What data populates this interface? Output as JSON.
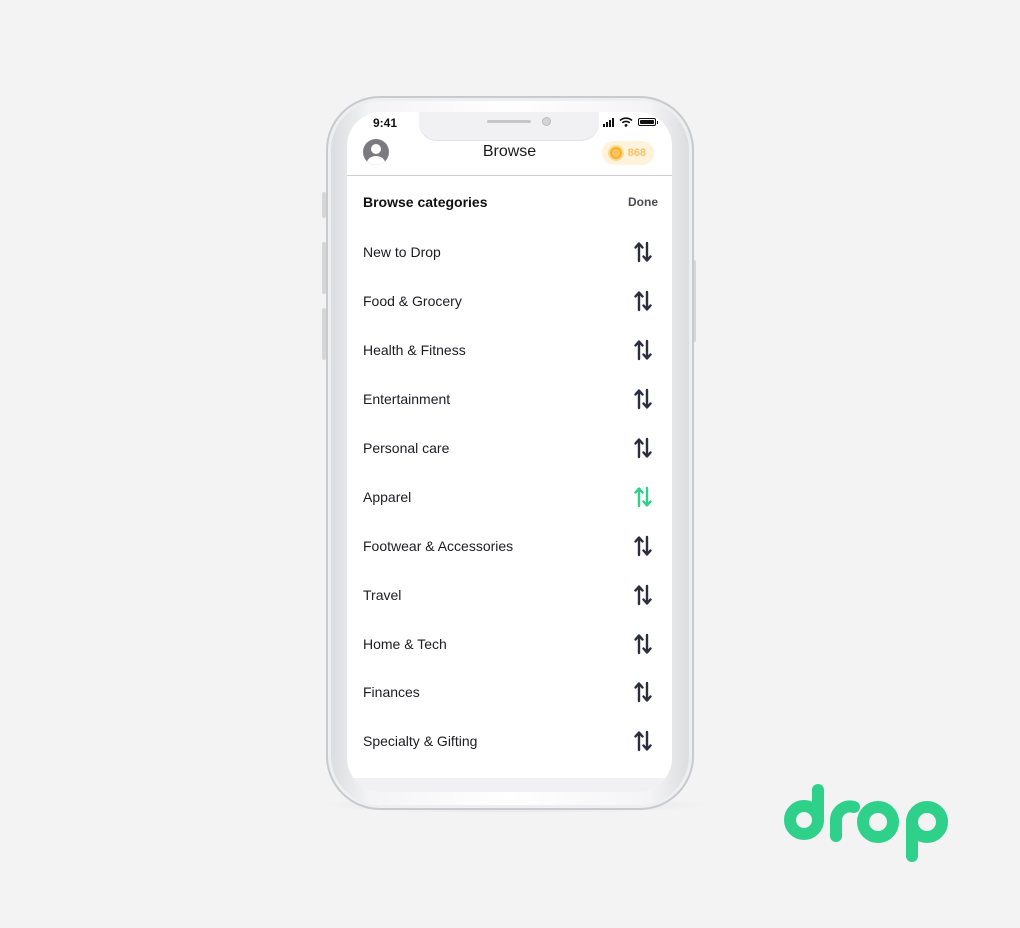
{
  "status_bar": {
    "time": "9:41"
  },
  "header": {
    "title": "Browse",
    "points": "868",
    "icons": {
      "profile": "user-avatar-icon",
      "coin": "coin-icon"
    }
  },
  "browse": {
    "title": "Browse categories",
    "done_label": "Done",
    "categories": [
      {
        "label": "New to Drop",
        "active": false
      },
      {
        "label": "Food & Grocery",
        "active": false
      },
      {
        "label": "Health & Fitness",
        "active": false
      },
      {
        "label": "Entertainment",
        "active": false
      },
      {
        "label": "Personal care",
        "active": false
      },
      {
        "label": "Apparel",
        "active": true
      },
      {
        "label": "Footwear & Accessories",
        "active": false
      },
      {
        "label": "Travel",
        "active": false
      },
      {
        "label": "Home & Tech",
        "active": false
      },
      {
        "label": "Finances",
        "active": false
      },
      {
        "label": "Specialty & Gifting",
        "active": false
      }
    ],
    "row_icon": "reorder-arrows-icon"
  },
  "brand": {
    "logo": "drop",
    "accent_color": "#2ed08a",
    "icon_color": "#2c2e3e"
  }
}
